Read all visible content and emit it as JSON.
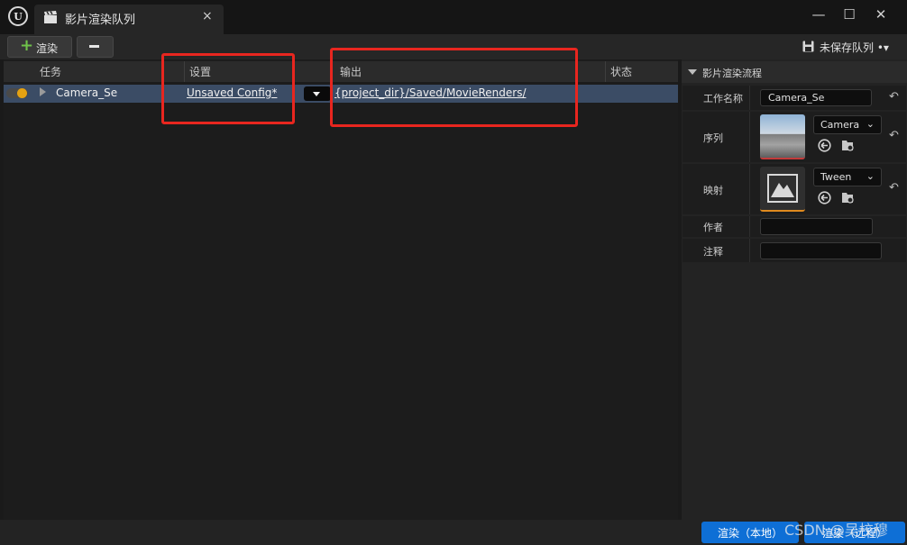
{
  "window": {
    "tab_title": "影片渲染队列",
    "tab_close": "×",
    "minimize": "—",
    "maximize": "☐",
    "close": "✕"
  },
  "toolbar": {
    "render_label": "渲染",
    "save_label": "未保存队列 •▾"
  },
  "job_list": {
    "columns": [
      "任务",
      "设置",
      "输出",
      "状态"
    ],
    "jobs": [
      {
        "name": "Camera_Se",
        "config": "Unsaved Config*",
        "output": "{project_dir}/Saved/MovieRenders/",
        "status": ""
      }
    ]
  },
  "details": {
    "title": "影片渲染流程",
    "job_name_label": "工作名称",
    "job_name_value": "Camera_Se",
    "sequence_label": "序列",
    "sequence_value": "Camera",
    "map_label": "映射",
    "map_value": "Tween",
    "author_label": "作者",
    "author_value": "",
    "comment_label": "注释",
    "comment_value": ""
  },
  "bottom": {
    "render_local": "渲染（本地）",
    "render_remote": "渲染（远程）",
    "watermark": "CSDN @吴校穆"
  },
  "colors": {
    "accent_blue": "#0e6fd6",
    "selected_row": "#3b4c65",
    "status_dot": "#e5a212",
    "annotation_red": "#e8261f"
  }
}
